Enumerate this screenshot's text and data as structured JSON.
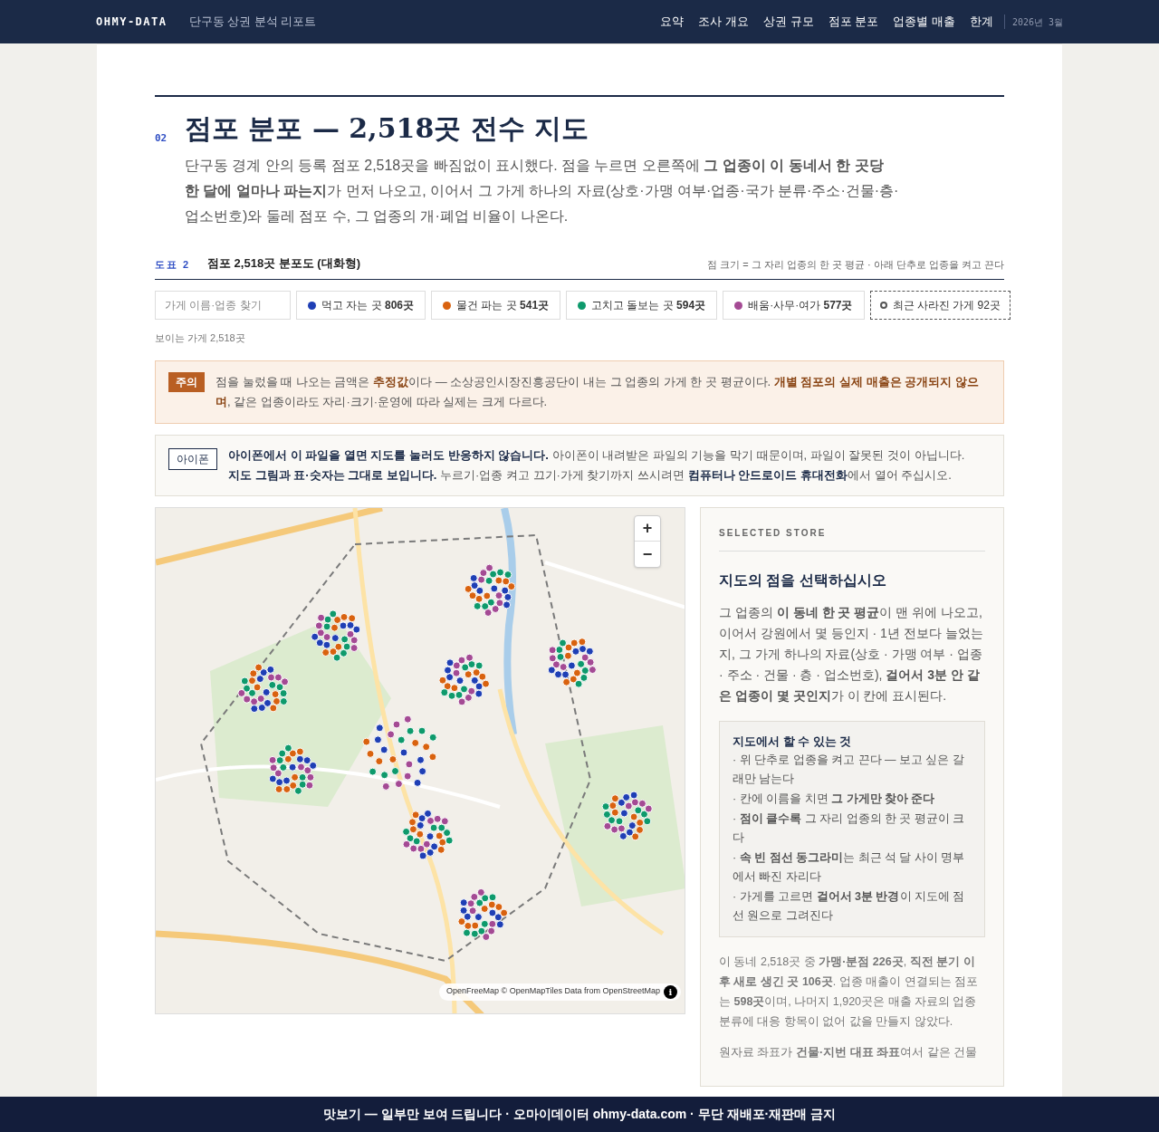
{
  "nav": {
    "brand": "OHMY-DATA",
    "report_title": "단구동 상권 분석 리포트",
    "links": [
      {
        "label": "요약"
      },
      {
        "label": "조사 개요"
      },
      {
        "label": "상권 규모"
      },
      {
        "label": "점포 분포"
      },
      {
        "label": "업종별 매출"
      },
      {
        "label": "한계"
      }
    ],
    "date": "2026년 3월"
  },
  "section": {
    "number": "02",
    "title": "점포 분포 — 2,518곳 전수 지도",
    "intro": "단구동 경계 안의 등록 점포 2,518곳을 빠짐없이 표시했다. 점을 누르면 오른쪽에 **그 업종이 이 동네서 한 곳당 한 달에 얼마나 파는지**가 먼저 나오고, 이어서 그 가게 하나의 자료(상호·가맹 여부·업종·국가 분류·주소·건물·층·업소번호)와 둘레 점포 수, 그 업종의 개·폐업 비율이 나온다."
  },
  "figure": {
    "label": "도표 2",
    "title": "점포 2,518곳 분포도 (대화형)",
    "note": "점 크기 = 그 자리 업종의 한 곳 평균 · 아래 단추로 업종을 켜고 끈다"
  },
  "search": {
    "placeholder": "가게 이름·업종 찾기"
  },
  "filters": [
    {
      "kind": "category",
      "label": "먹고 자는 곳",
      "count": "806곳",
      "color": "#1f3fb5"
    },
    {
      "kind": "category",
      "label": "물건 파는 곳",
      "count": "541곳",
      "color": "#d9620f"
    },
    {
      "kind": "category",
      "label": "고치고 돌보는 곳",
      "count": "594곳",
      "color": "#0e9a6c"
    },
    {
      "kind": "category",
      "label": "배움·사무·여가",
      "count": "577곳",
      "color": "#a44a94"
    },
    {
      "kind": "closed",
      "label": "최근 사라진 가게 92곳"
    }
  ],
  "visible_count": "보이는 가게 2,518곳",
  "notices": [
    {
      "kind": "warning",
      "badge": "주의",
      "text": "점을 눌렀을 때 나오는 금액은 **추정값**이다 — 소상공인시장진흥공단이 내는 그 업종의 가게 한 곳 평균이다. **개별 점포의 실제 매출은 공개되지 않으며**, 같은 업종이라도 자리·크기·운영에 따라 실제는 크게 다르다."
    },
    {
      "kind": "info",
      "badge": "아이폰",
      "text": "**아이폰에서 이 파일을 열면 지도를 눌러도 반응하지 않습니다.** 아이폰이 내려받은 파일의 기능을 막기 때문이며, 파일이 잘못된 것이 아닙니다. **지도 그림과 표·숫자는 그대로 보입니다.** 누르기·업종 켜고 끄기·가게 찾기까지 쓰시려면 **컴퓨터나 안드로이드 휴대전화**에서 열어 주십시오."
    }
  ],
  "map": {
    "zoom_in": "+",
    "zoom_out": "−",
    "attribution": "OpenFreeMap © OpenMapTiles Data from OpenStreetMap",
    "info": "i"
  },
  "panel": {
    "eyebrow": "SELECTED STORE",
    "heading": "지도의 점을 선택하십시오",
    "intro": "그 업종의 **이 동네 한 곳 평균**이 맨 위에 나오고, 이어서 강원에서 몇 등인지 · 1년 전보다 늘었는지, 그 가게 하나의 자료(상호 · 가맹 여부 · 업종 · 주소 · 건물 · 층 · 업소번호), **걸어서 3분 안 같은 업종이 몇 곳인지**가 이 칸에 표시된다.",
    "help_title": "지도에서 할 수 있는 것",
    "help_items": [
      "· 위 단추로 업종을 켜고 끈다 — 보고 싶은 갈래만 남는다",
      "· 칸에 이름을 치면 **그 가게만 찾아 준다**",
      "· **점이 클수록** 그 자리 업종의 한 곳 평균이 크다",
      "· **속 빈 점선 동그라미**는 최근 석 달 사이 명부에서 빠진 자리다",
      "· 가게를 고르면 **걸어서 3분 반경**이 지도에 점선 원으로 그려진다"
    ],
    "notes": [
      "이 동네 2,518곳 중 **가맹·분점 226곳**, **직전 분기 이후 새로 생긴 곳 106곳**. 업종 매출이 연결되는 점포는 **598곳**이며, 나머지 1,920곳은 매출 자료의 업종 분류에 대응 항목이 없어 값을 만들지 않았다.",
      "원자료 좌표가 **건물·지번 대표 좌표**여서 같은 건물"
    ]
  },
  "banner": "맛보기 — 일부만 보여 드립니다 · 오마이데이터 ohmy-data.com · 무단 재배포·재판매 금지"
}
